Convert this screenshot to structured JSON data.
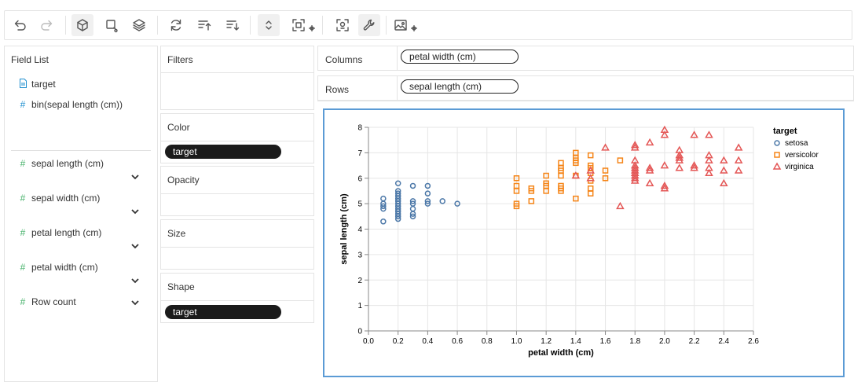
{
  "toolbar": {
    "buttons": [
      {
        "name": "undo-icon",
        "enabled": true
      },
      {
        "name": "redo-icon",
        "enabled": false
      },
      {
        "name": "cube-icon",
        "active": true
      },
      {
        "name": "brush-icon"
      },
      {
        "name": "layers-icon"
      },
      {
        "name": "refresh-icon"
      },
      {
        "name": "sort-ascending-icon"
      },
      {
        "name": "sort-descending-icon"
      },
      {
        "name": "expand-collapse-icon"
      },
      {
        "name": "fit-screen-icon"
      },
      {
        "name": "tooltip-config-icon"
      },
      {
        "name": "wrench-icon",
        "active": true
      },
      {
        "name": "image-export-icon"
      }
    ]
  },
  "field_list": {
    "title": "Field List",
    "dimensions": [
      {
        "label": "target",
        "icon": "text-doc-icon"
      },
      {
        "label": "bin(sepal length (cm))",
        "icon": "hash-icon"
      }
    ],
    "measures": [
      {
        "label": "sepal length (cm)",
        "icon": "hash-icon"
      },
      {
        "label": "sepal width (cm)",
        "icon": "hash-icon"
      },
      {
        "label": "petal length (cm)",
        "icon": "hash-icon"
      },
      {
        "label": "petal width (cm)",
        "icon": "hash-icon"
      },
      {
        "label": "Row count",
        "icon": "hash-icon"
      }
    ]
  },
  "encodings": {
    "filters_label": "Filters",
    "color_label": "Color",
    "color_field": "target",
    "opacity_label": "Opacity",
    "size_label": "Size",
    "shape_label": "Shape",
    "shape_field": "target"
  },
  "shelves": {
    "columns_label": "Columns",
    "columns_field": "petal width (cm)",
    "rows_label": "Rows",
    "rows_field": "sepal length (cm)"
  },
  "chart_data": {
    "type": "scatter",
    "xlabel": "petal width (cm)",
    "ylabel": "sepal length (cm)",
    "xlim": [
      0,
      2.6
    ],
    "ylim": [
      0,
      8
    ],
    "x_ticks": [
      "0.0",
      "0.2",
      "0.4",
      "0.6",
      "0.8",
      "1.0",
      "1.2",
      "1.4",
      "1.6",
      "1.8",
      "2.0",
      "2.2",
      "2.4",
      "2.6"
    ],
    "y_ticks": [
      "0",
      "1",
      "2",
      "3",
      "4",
      "5",
      "6",
      "7",
      "8"
    ],
    "grid": true,
    "legend_title": "target",
    "legend_position": "top-right",
    "series": [
      {
        "name": "setosa",
        "shape": "circle",
        "color": "#4c78a8",
        "points": [
          [
            0.1,
            5.2
          ],
          [
            0.1,
            4.9
          ],
          [
            0.1,
            4.8
          ],
          [
            0.1,
            4.3
          ],
          [
            0.1,
            5.0
          ],
          [
            0.2,
            5.8
          ],
          [
            0.2,
            5.5
          ],
          [
            0.2,
            5.4
          ],
          [
            0.2,
            5.3
          ],
          [
            0.2,
            5.2
          ],
          [
            0.2,
            5.1
          ],
          [
            0.2,
            5.0
          ],
          [
            0.2,
            4.9
          ],
          [
            0.2,
            4.8
          ],
          [
            0.2,
            4.7
          ],
          [
            0.2,
            4.6
          ],
          [
            0.2,
            4.5
          ],
          [
            0.2,
            4.4
          ],
          [
            0.3,
            5.7
          ],
          [
            0.3,
            5.1
          ],
          [
            0.3,
            5.0
          ],
          [
            0.3,
            4.8
          ],
          [
            0.3,
            4.6
          ],
          [
            0.3,
            4.5
          ],
          [
            0.4,
            5.7
          ],
          [
            0.4,
            5.4
          ],
          [
            0.4,
            5.1
          ],
          [
            0.4,
            5.0
          ],
          [
            0.5,
            5.1
          ],
          [
            0.6,
            5.0
          ]
        ]
      },
      {
        "name": "versicolor",
        "shape": "square",
        "color": "#f58518",
        "points": [
          [
            1.0,
            6.0
          ],
          [
            1.0,
            5.7
          ],
          [
            1.0,
            5.5
          ],
          [
            1.0,
            5.0
          ],
          [
            1.0,
            4.9
          ],
          [
            1.1,
            5.6
          ],
          [
            1.1,
            5.5
          ],
          [
            1.1,
            5.1
          ],
          [
            1.2,
            6.1
          ],
          [
            1.2,
            5.8
          ],
          [
            1.2,
            5.7
          ],
          [
            1.2,
            5.5
          ],
          [
            1.3,
            6.6
          ],
          [
            1.3,
            6.4
          ],
          [
            1.3,
            6.3
          ],
          [
            1.3,
            6.1
          ],
          [
            1.3,
            5.7
          ],
          [
            1.3,
            5.6
          ],
          [
            1.3,
            5.5
          ],
          [
            1.4,
            7.0
          ],
          [
            1.4,
            6.8
          ],
          [
            1.4,
            6.7
          ],
          [
            1.4,
            6.6
          ],
          [
            1.4,
            6.1
          ],
          [
            1.4,
            5.2
          ],
          [
            1.5,
            6.9
          ],
          [
            1.5,
            6.5
          ],
          [
            1.5,
            6.4
          ],
          [
            1.5,
            6.2
          ],
          [
            1.5,
            5.9
          ],
          [
            1.5,
            5.6
          ],
          [
            1.5,
            5.4
          ],
          [
            1.6,
            6.3
          ],
          [
            1.6,
            6.0
          ],
          [
            1.7,
            6.7
          ]
        ]
      },
      {
        "name": "virginica",
        "shape": "triangle",
        "color": "#e45756",
        "points": [
          [
            1.4,
            6.1
          ],
          [
            1.5,
            6.3
          ],
          [
            1.5,
            6.0
          ],
          [
            1.6,
            7.2
          ],
          [
            1.7,
            4.9
          ],
          [
            1.8,
            7.3
          ],
          [
            1.8,
            7.2
          ],
          [
            1.8,
            6.7
          ],
          [
            1.8,
            6.5
          ],
          [
            1.8,
            6.4
          ],
          [
            1.8,
            6.3
          ],
          [
            1.8,
            6.2
          ],
          [
            1.8,
            6.1
          ],
          [
            1.8,
            6.0
          ],
          [
            1.8,
            5.9
          ],
          [
            1.9,
            7.4
          ],
          [
            1.9,
            6.4
          ],
          [
            1.9,
            6.3
          ],
          [
            1.9,
            5.8
          ],
          [
            2.0,
            7.9
          ],
          [
            2.0,
            7.7
          ],
          [
            2.0,
            6.5
          ],
          [
            2.0,
            5.7
          ],
          [
            2.0,
            5.6
          ],
          [
            2.1,
            7.1
          ],
          [
            2.1,
            6.9
          ],
          [
            2.1,
            6.8
          ],
          [
            2.1,
            6.7
          ],
          [
            2.1,
            6.4
          ],
          [
            2.2,
            7.7
          ],
          [
            2.2,
            6.5
          ],
          [
            2.2,
            6.4
          ],
          [
            2.3,
            7.7
          ],
          [
            2.3,
            6.9
          ],
          [
            2.3,
            6.7
          ],
          [
            2.3,
            6.4
          ],
          [
            2.3,
            6.2
          ],
          [
            2.4,
            6.7
          ],
          [
            2.4,
            6.3
          ],
          [
            2.4,
            5.8
          ],
          [
            2.5,
            7.2
          ],
          [
            2.5,
            6.7
          ],
          [
            2.5,
            6.3
          ]
        ]
      }
    ]
  }
}
